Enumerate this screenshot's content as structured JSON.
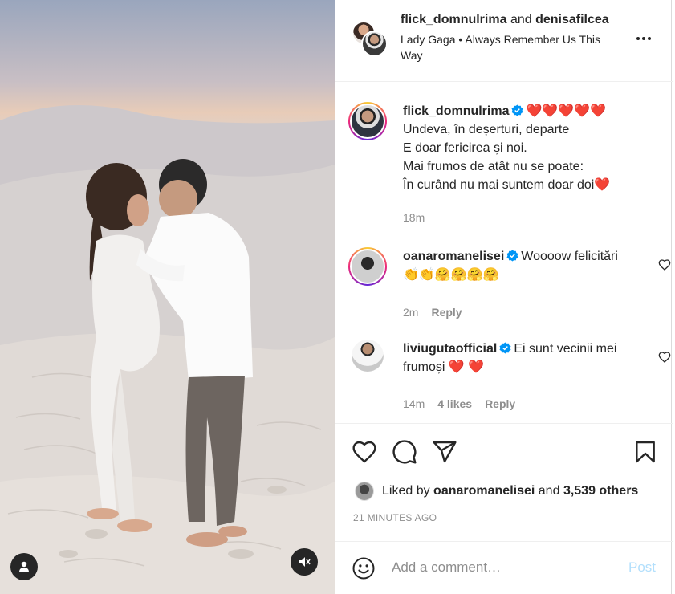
{
  "media": {
    "user_icon": "user-tag-icon",
    "audio_icon": "speaker-muted-icon"
  },
  "header": {
    "user1": "flick_domnulrima",
    "and_text": "and",
    "user2": "denisafilcea",
    "audio_artist": "Lady Gaga",
    "separator": "•",
    "audio_track": "Always Remember Us This Way",
    "more_icon": "more-horizontal-icon"
  },
  "caption": {
    "username": "flick_domnulrima",
    "hearts": "❤️❤️❤️❤️❤️",
    "lines": [
      "Undeva, în deșerturi, departe",
      "E doar fericirea și noi.",
      "Mai frumos de atât nu se poate:",
      "În curând nu mai suntem doar doi❤️"
    ],
    "time": "18m"
  },
  "comments": [
    {
      "username": "oanaromanelisei",
      "text": "Woooow felicitări 👏👏🤗🤗🤗🤗",
      "time": "2m",
      "likes": "",
      "reply": "Reply"
    },
    {
      "username": "liviugutaofficial",
      "text": "Ei sunt vecinii mei frumoși ❤️ ❤️",
      "time": "14m",
      "likes": "4 likes",
      "reply": "Reply"
    }
  ],
  "actions": {
    "like_icon": "heart-icon",
    "comment_icon": "comment-bubble-icon",
    "share_icon": "paper-plane-icon",
    "save_icon": "bookmark-icon"
  },
  "likes": {
    "prefix": "Liked by",
    "user": "oanaromanelisei",
    "and_text": "and",
    "count": "3,539 others"
  },
  "timestamp": "21 MINUTES AGO",
  "add_comment": {
    "placeholder": "Add a comment…",
    "post_label": "Post",
    "emoji_icon": "smiley-icon"
  },
  "colors": {
    "verified": "#0095f6",
    "heart": "#ed4956",
    "post_disabled": "#b2dffc",
    "muted": "#8e8e8e"
  }
}
